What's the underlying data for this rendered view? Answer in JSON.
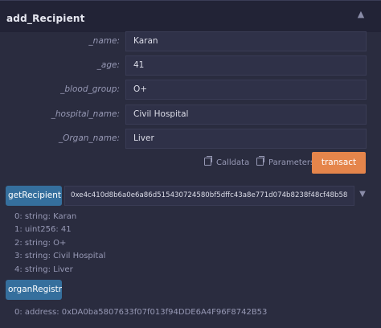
{
  "function_title": "add_Recipient",
  "params": [
    {
      "label": "_name:",
      "value": "Karan"
    },
    {
      "label": "_age:",
      "value": "41"
    },
    {
      "label": "_blood_group:",
      "value": "O+"
    },
    {
      "label": "_hospital_name:",
      "value": "Civil Hospital"
    },
    {
      "label": "_Organ_name:",
      "value": "Liver"
    }
  ],
  "actions": {
    "calldata_label": "Calldata",
    "parameters_label": "Parameters",
    "transact_label": "transact"
  },
  "getRecipient": {
    "button_label": "getRecipient",
    "input_value": "0xe4c410d8b6a0e6a86d515430724580bf5dffc43a8e771d074b8238f48cf48b58",
    "outputs": [
      "0: string: Karan",
      "1: uint256: 41",
      "2: string: O+",
      "3: string: Civil Hospital",
      "4: string: Liver"
    ]
  },
  "organRegistryl": {
    "button_label": "organRegistryl",
    "outputs": [
      "0: address: 0xDA0ba5807633f07f013f94DDE6A4F96F8742B53"
    ]
  },
  "colors": {
    "background": "#2a2c3f",
    "header": "#222336",
    "input": "#2f3148",
    "transact": "#e5854b",
    "call_button": "#356f9d"
  },
  "icons": {
    "collapse": "chevron-up-icon",
    "expand": "chevron-down-icon",
    "copy": "copy-icon"
  }
}
